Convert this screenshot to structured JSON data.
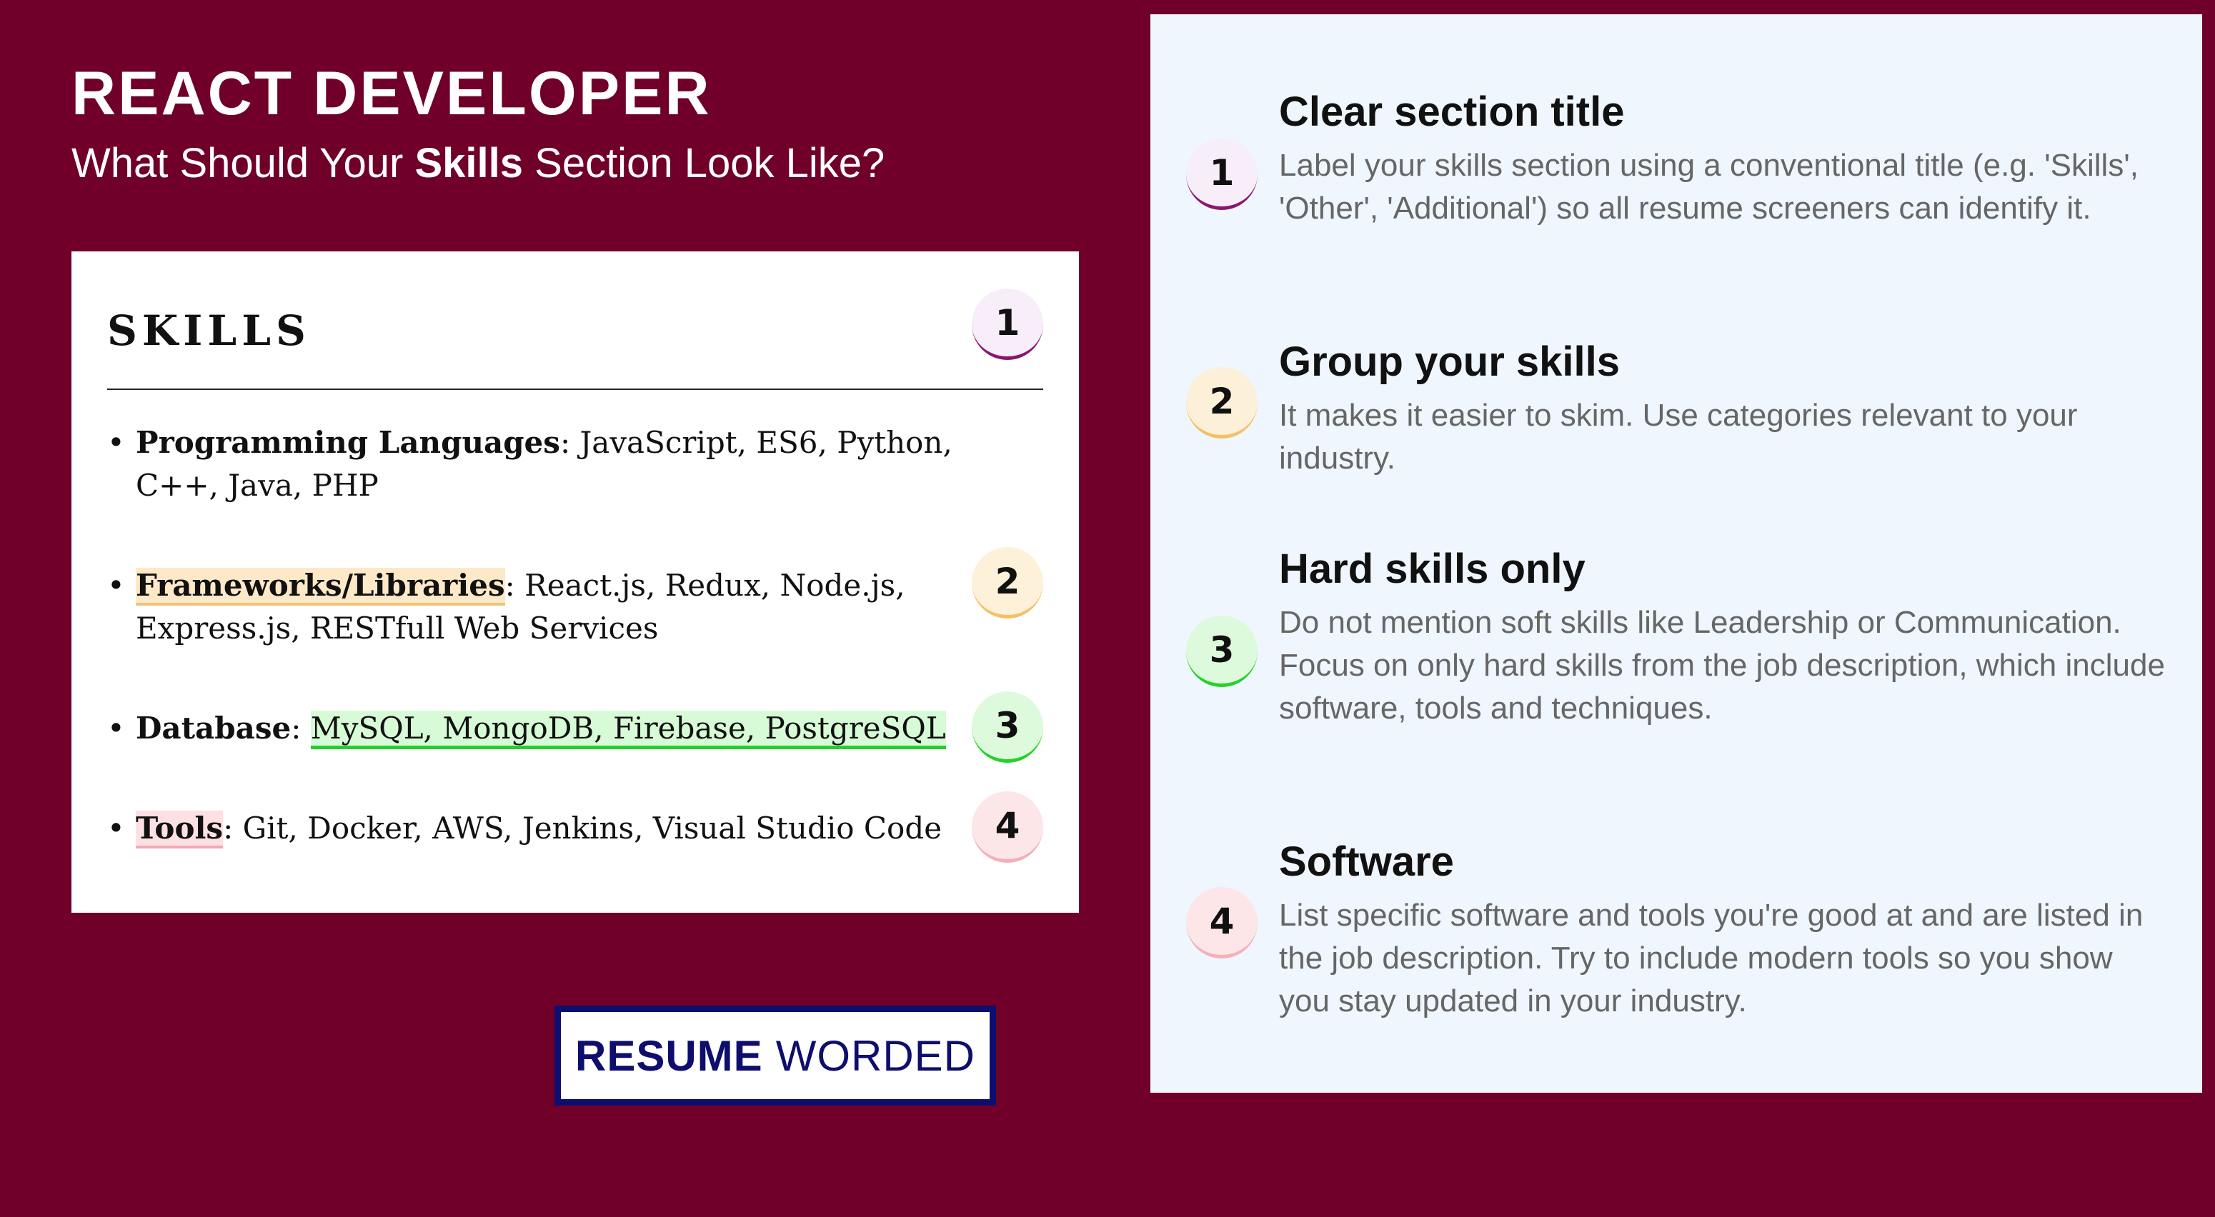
{
  "header": {
    "title": "REACT DEVELOPER",
    "subtitle_before": "What Should Your ",
    "subtitle_bold": "Skills",
    "subtitle_after": " Section Look Like?"
  },
  "card": {
    "heading": "SKILLS",
    "badges": [
      "1",
      "2",
      "3",
      "4"
    ],
    "rows": [
      {
        "bullet": "•",
        "category": "Programming Languages",
        "sep": ": ",
        "text": "JavaScript, ES6, Python, C++, Java, PHP"
      },
      {
        "bullet": "•",
        "category": "Frameworks/Libraries",
        "sep": ": ",
        "text": "React.js, Redux, Node.js, Express.js, RESTfull Web Services"
      },
      {
        "bullet": "•",
        "category": "Database",
        "sep": ": ",
        "text": "MySQL, MongoDB, Firebase, PostgreSQL"
      },
      {
        "bullet": "•",
        "category": "Tools",
        "sep": ": ",
        "text": "Git, Docker, AWS, Jenkins, Visual Studio Code"
      }
    ]
  },
  "logo": {
    "strong": "RESUME",
    "light": "WORDED"
  },
  "tips": [
    {
      "number": "1",
      "title": "Clear section title",
      "body": "Label your skills section using a conventional title (e.g. 'Skills', 'Other', 'Additional') so all resume screeners can identify it."
    },
    {
      "number": "2",
      "title": "Group your skills",
      "body": "It makes it easier to skim. Use categories relevant to your industry."
    },
    {
      "number": "3",
      "title": "Hard skills only",
      "body": "Do not mention soft skills like Leadership or Communication. Focus on only hard skills from the job description, which include software, tools and techniques."
    },
    {
      "number": "4",
      "title": "Software",
      "body": "List specific software and tools you're good at and are listed in the job description. Try to include modern tools so you show you stay updated in your industry."
    }
  ],
  "colors": {
    "background": "#70002a",
    "panel": "#eff6fd",
    "logo": "#0e0e6e",
    "badge1": "#8a1670",
    "badge2": "#f5c064",
    "badge3": "#28d02a",
    "badge4": "#f3b0b8"
  }
}
